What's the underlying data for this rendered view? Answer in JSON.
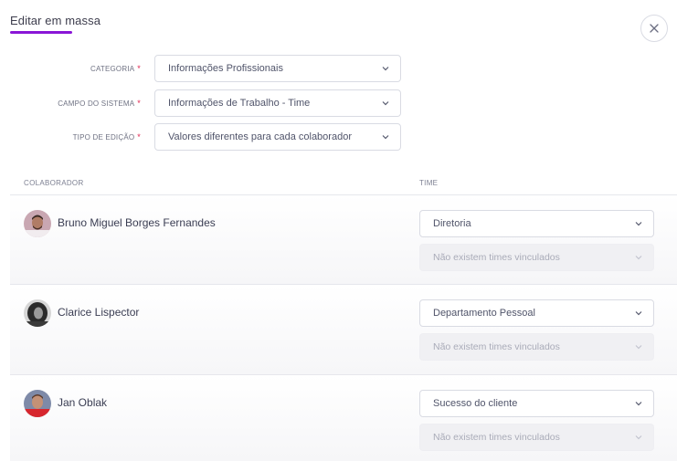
{
  "modal": {
    "title": "Editar em massa",
    "accent_color": "#8a16d6",
    "close_icon": "close-icon"
  },
  "form": {
    "required_mark": "*",
    "fields": [
      {
        "label": "CATEGORIA",
        "value": "Informações Profissionais"
      },
      {
        "label": "CAMPO DO SISTEMA",
        "value": "Informações de Trabalho - Time"
      },
      {
        "label": "TIPO DE EDIÇÃO",
        "value": "Valores diferentes para cada colaborador"
      }
    ]
  },
  "table": {
    "headers": {
      "employee": "COLABORADOR",
      "team": "TIME"
    },
    "rows": [
      {
        "name": "Bruno Miguel Borges Fernandes",
        "team": "Diretoria",
        "subteam_placeholder": "Não existem times vinculados"
      },
      {
        "name": "Clarice Lispector",
        "team": "Departamento Pessoal",
        "subteam_placeholder": "Não existem times vinculados"
      },
      {
        "name": "Jan Oblak",
        "team": "Sucesso do cliente",
        "subteam_placeholder": "Não existem times vinculados"
      }
    ]
  }
}
